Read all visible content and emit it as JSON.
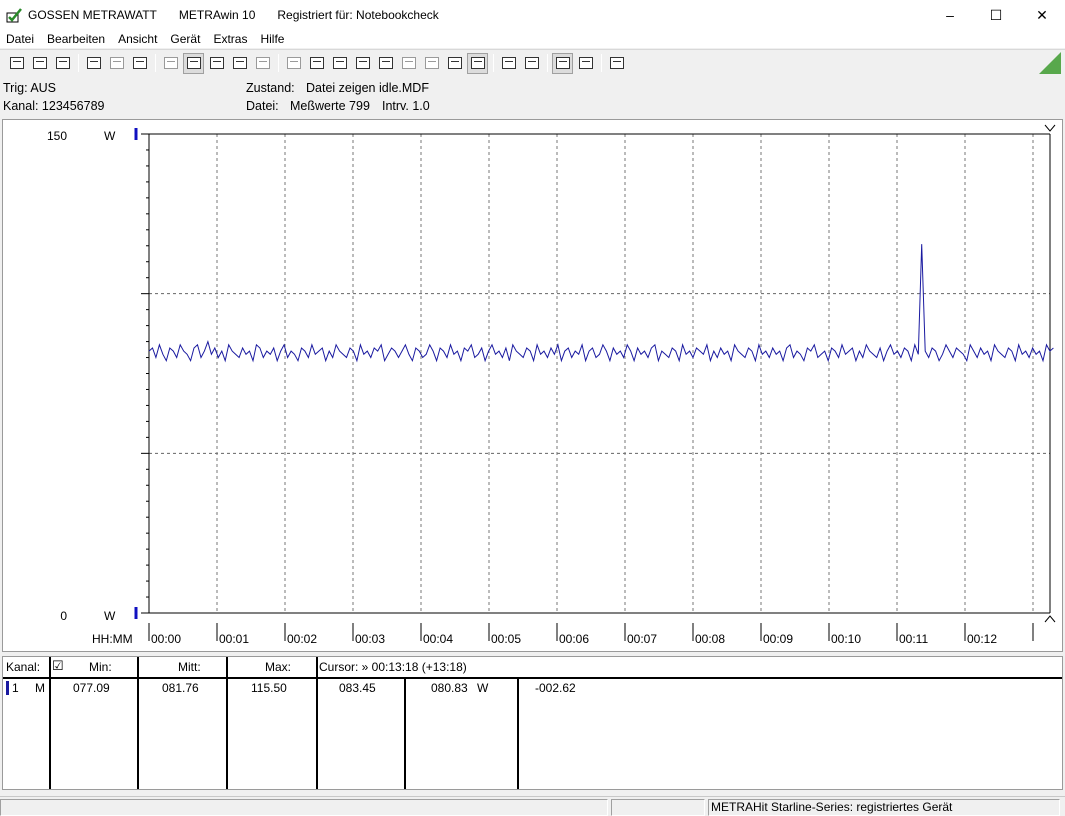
{
  "titlebar": {
    "company": "GOSSEN METRAWATT",
    "app": "METRAwin 10",
    "registered": "Registriert für: Notebookcheck",
    "minimize": "–",
    "maximize": "☐",
    "close": "✕"
  },
  "menu": [
    "Datei",
    "Bearbeiten",
    "Ansicht",
    "Gerät",
    "Extras",
    "Hilfe"
  ],
  "info": {
    "trig": "Trig: AUS",
    "kanal": "Kanal: 123456789",
    "zustand_label": "Zustand:",
    "zustand_value": "Datei zeigen idle.MDF",
    "datei_label": "Datei:",
    "datei_value": "Meßwerte 799",
    "intrv": "Intrv. 1.0"
  },
  "chart_data": {
    "type": "line",
    "ymax_label": "150",
    "ymin_label": "0",
    "unit": "W",
    "xaxis_label": "HH:MM",
    "ylim": [
      0,
      150
    ],
    "xlim_minutes": [
      0,
      13.3
    ],
    "xticks": [
      "00:00",
      "00:01",
      "00:02",
      "00:03",
      "00:04",
      "00:05",
      "00:06",
      "00:07",
      "00:08",
      "00:09",
      "00:10",
      "00:11",
      "00:12"
    ],
    "grid": true,
    "series": [
      {
        "color": "#1a1aa0",
        "baseline": 81.76,
        "min": 77.09,
        "max": 115.5,
        "spike_minute": 11.58,
        "values": [
          82,
          83,
          80,
          84,
          81,
          79,
          83,
          82,
          80,
          84,
          82,
          81,
          79,
          83,
          84,
          80,
          82,
          85,
          81,
          83,
          80,
          82,
          79,
          84,
          82,
          81,
          80,
          83,
          81,
          82,
          79,
          84,
          83,
          80,
          82,
          81,
          83,
          79,
          82,
          84,
          80,
          82,
          81,
          79,
          83,
          82,
          80,
          84,
          81,
          82,
          83,
          79,
          82,
          80,
          84,
          82,
          81,
          80,
          83,
          82,
          79,
          84,
          81,
          82,
          80,
          83,
          82,
          84,
          79,
          81,
          83,
          82,
          80,
          82,
          84,
          81,
          79,
          83,
          82,
          80,
          81,
          84,
          82,
          79,
          83,
          82,
          80,
          84,
          81,
          82,
          79,
          83,
          82,
          84,
          80,
          81,
          83,
          79,
          82,
          84,
          81,
          82,
          80,
          83,
          79,
          84,
          82,
          81,
          80,
          83,
          82,
          79,
          84,
          81,
          82,
          80,
          83,
          81,
          84,
          79,
          82,
          83,
          80,
          82,
          81,
          84,
          79,
          82,
          83,
          80,
          81,
          84,
          82,
          79,
          83,
          81,
          82,
          80,
          84,
          82,
          79,
          83,
          81,
          82,
          80,
          83,
          84,
          79,
          82,
          81,
          80,
          83,
          82,
          79,
          84,
          81,
          82,
          80,
          83,
          82,
          81,
          84,
          79,
          82,
          80,
          83,
          81,
          82,
          79,
          84,
          82,
          81,
          80,
          83,
          82,
          79,
          84,
          81,
          82,
          80,
          83,
          81,
          82,
          79,
          83,
          84,
          80,
          82,
          81,
          79,
          83,
          82,
          84,
          80,
          81,
          82,
          79,
          83,
          82,
          80,
          84,
          81,
          82,
          83,
          79,
          82,
          80,
          84,
          82,
          81,
          80,
          83,
          79,
          82,
          84,
          81,
          82,
          80,
          83,
          82,
          79,
          84,
          81,
          115.5,
          82,
          80,
          83,
          82,
          79,
          81,
          84,
          82,
          80,
          83,
          82,
          81,
          79,
          84,
          82,
          80,
          83,
          81,
          82,
          79,
          84,
          82,
          81,
          80,
          83,
          82,
          79,
          84,
          81,
          82,
          80,
          83,
          81,
          82,
          79,
          84,
          82,
          83
        ]
      }
    ]
  },
  "table": {
    "headers": {
      "kanal": "Kanal:",
      "check": "☑",
      "min": "Min:",
      "mitt": "Mitt:",
      "max": "Max:",
      "cursor": "Cursor: » 00:13:18 (+13:18)"
    },
    "row": {
      "channel": "1",
      "mode": "M",
      "min": "077.09",
      "mitt": "081.76",
      "max": "115.50",
      "cursor1": "083.45",
      "cursor2": "080.83",
      "unit": "W",
      "delta": "-002.62"
    }
  },
  "status": {
    "device": "METRAHit Starline-Series: registriertes Gerät"
  }
}
